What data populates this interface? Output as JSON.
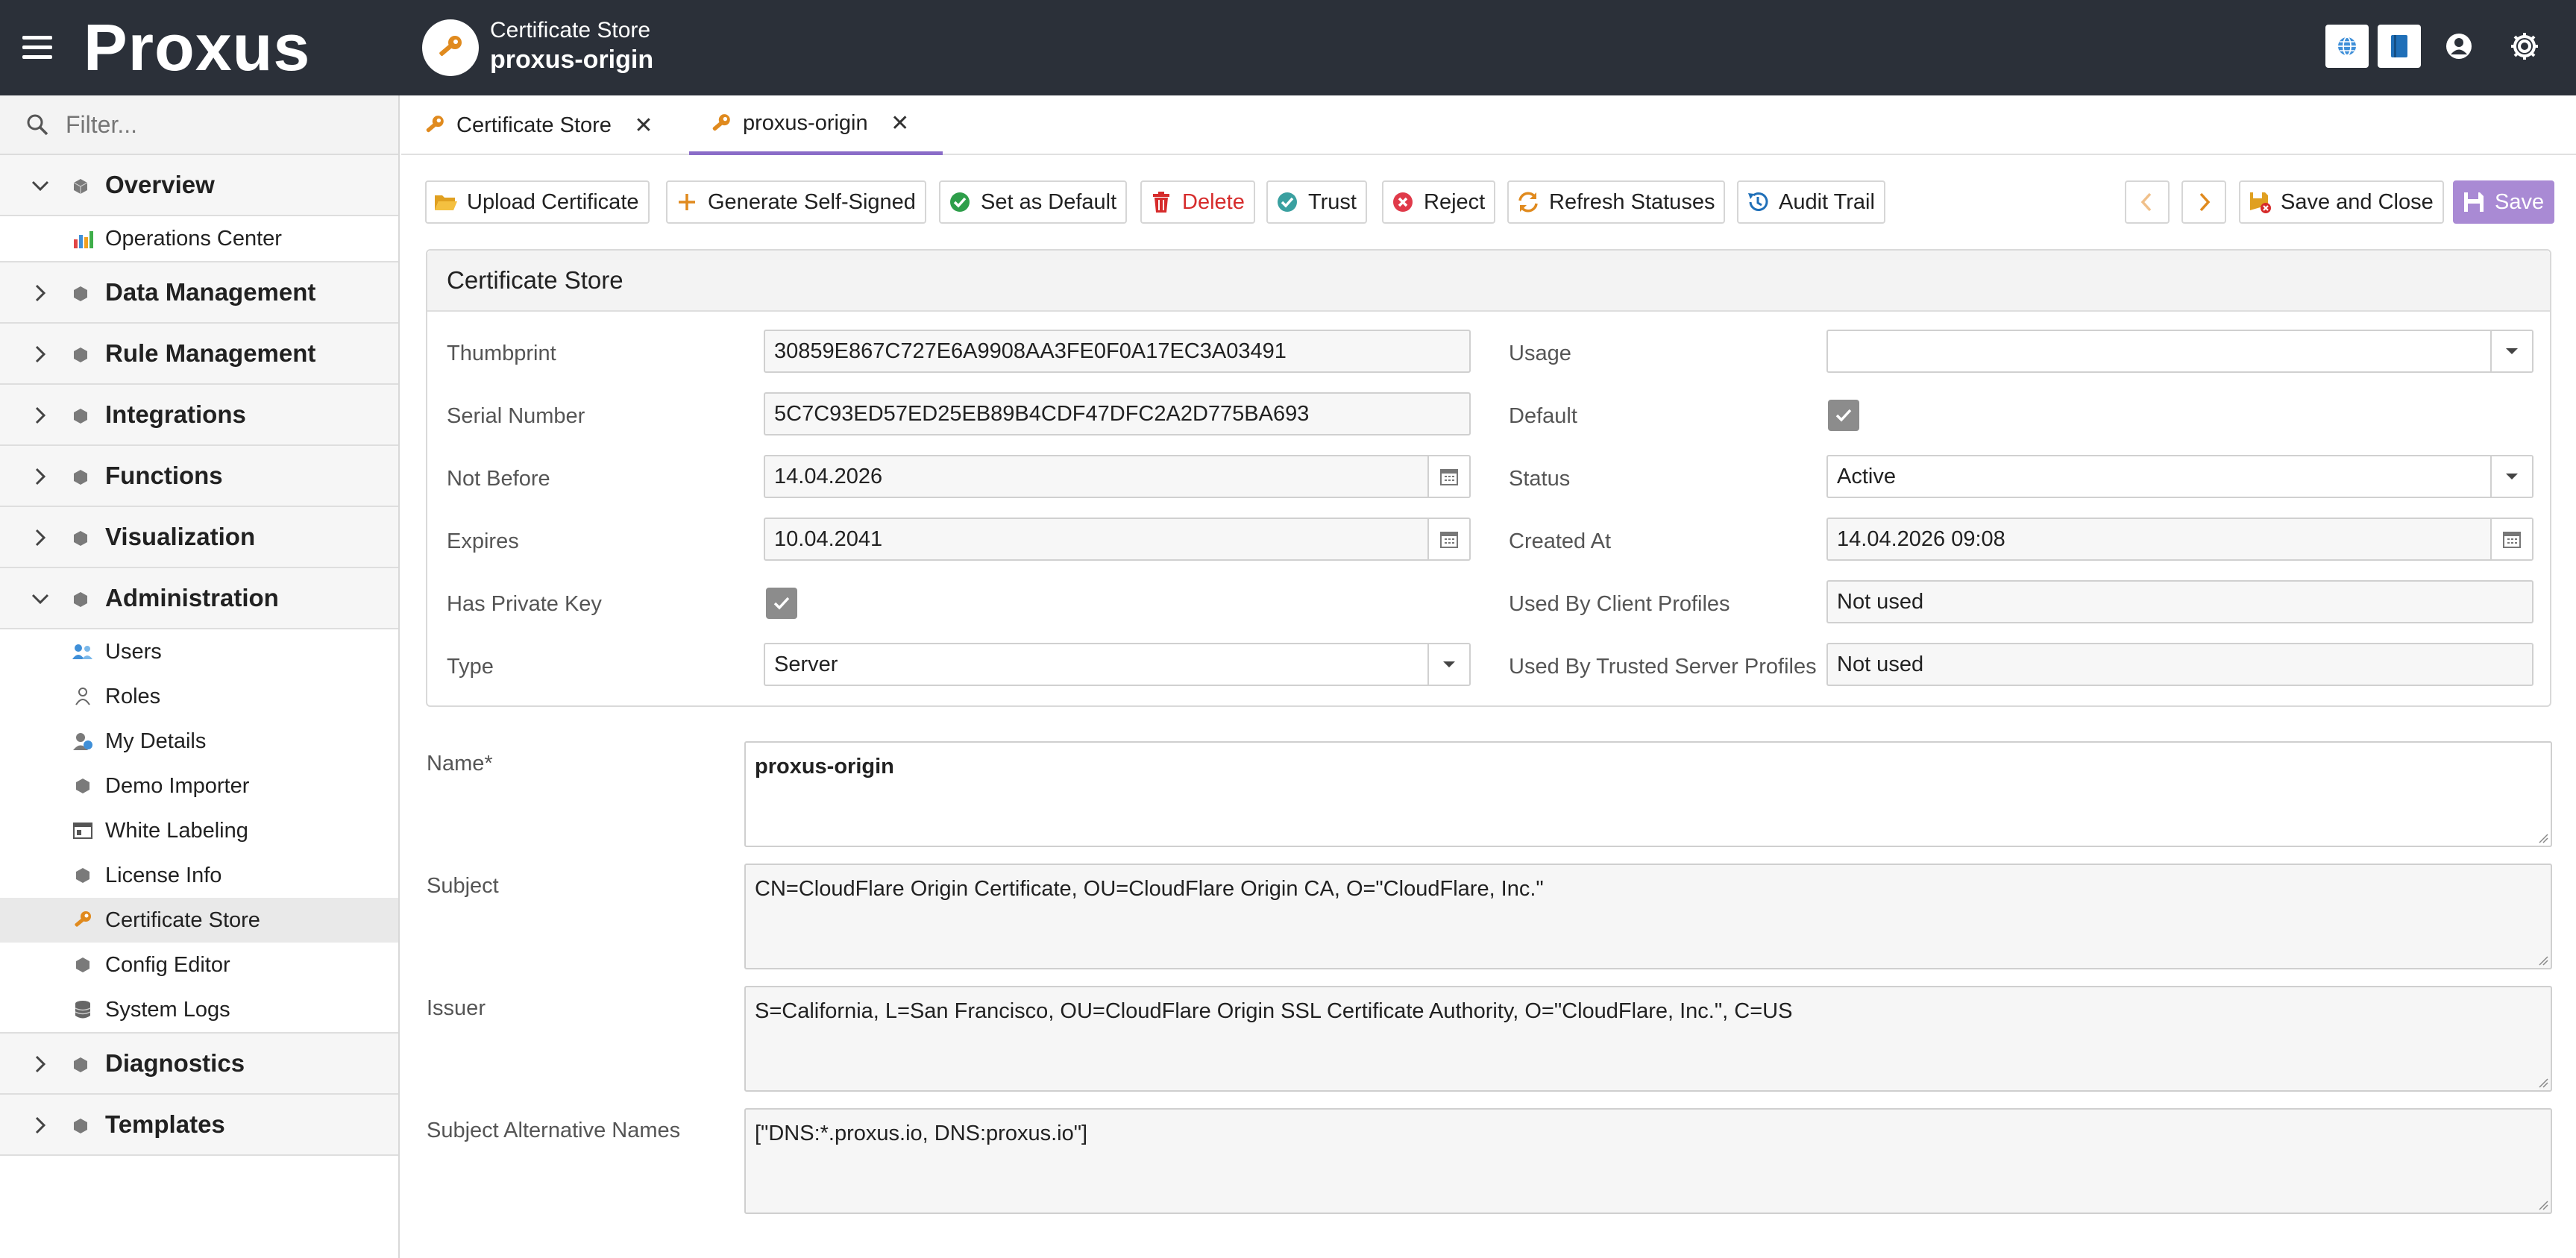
{
  "header": {
    "logo": "Proxus",
    "app_subtitle": "Certificate Store",
    "app_title": "proxus-origin",
    "icons": [
      "menu-icon",
      "key-icon",
      "globe-icon",
      "book-icon",
      "user-icon",
      "gear-icon"
    ]
  },
  "sidebar": {
    "filter_placeholder": "Filter...",
    "groups": {
      "overview": "Overview",
      "data_management": "Data Management",
      "rule_management": "Rule Management",
      "integrations": "Integrations",
      "functions": "Functions",
      "visualization": "Visualization",
      "administration": "Administration",
      "diagnostics": "Diagnostics",
      "templates": "Templates"
    },
    "overview_items": [
      "Operations Center"
    ],
    "administration_items": [
      "Users",
      "Roles",
      "My Details",
      "Demo Importer",
      "White Labeling",
      "License Info",
      "Certificate Store",
      "Config Editor",
      "System Logs"
    ],
    "active_item": "Certificate Store"
  },
  "tabs": [
    {
      "label": "Certificate Store",
      "active": false
    },
    {
      "label": "proxus-origin",
      "active": true
    }
  ],
  "toolbar": {
    "upload": "Upload Certificate",
    "generate": "Generate Self-Signed",
    "set_default": "Set as Default",
    "delete": "Delete",
    "trust": "Trust",
    "reject": "Reject",
    "refresh": "Refresh Statuses",
    "audit": "Audit Trail",
    "save_close": "Save and Close",
    "save": "Save"
  },
  "panel": {
    "title": "Certificate Store",
    "labels": {
      "thumbprint": "Thumbprint",
      "serial": "Serial Number",
      "not_before": "Not Before",
      "expires": "Expires",
      "has_private_key": "Has Private Key",
      "type": "Type",
      "usage": "Usage",
      "default": "Default",
      "status": "Status",
      "created_at": "Created At",
      "used_by_client": "Used By Client Profiles",
      "used_by_trusted": "Used By Trusted Server Profiles"
    },
    "values": {
      "thumbprint": "30859E867C727E6A9908AA3FE0F0A17EC3A03491",
      "serial": "5C7C93ED57ED25EB89B4CDF47DFC2A2D775BA693",
      "not_before": "14.04.2026",
      "expires": "10.04.2041",
      "has_private_key": true,
      "type": "Server",
      "usage": "",
      "default": true,
      "status": "Active",
      "created_at": "14.04.2026 09:08",
      "used_by_client": "Not used",
      "used_by_trusted": "Not used"
    }
  },
  "details": {
    "name_label": "Name*",
    "name": "proxus-origin",
    "subject_label": "Subject",
    "subject": "CN=CloudFlare Origin Certificate, OU=CloudFlare Origin CA, O=\"CloudFlare, Inc.\"",
    "issuer_label": "Issuer",
    "issuer": "S=California, L=San Francisco, OU=CloudFlare Origin SSL Certificate Authority, O=\"CloudFlare, Inc.\", C=US",
    "san_label": "Subject Alternative Names",
    "san": "[\"DNS:*.proxus.io, DNS:proxus.io\"]"
  },
  "colors": {
    "header_bg": "#2b3039",
    "accent": "#8a6cc8",
    "save_bg": "#a98ad4",
    "delete": "#d62b2b",
    "key_orange": "#e08a1e"
  }
}
